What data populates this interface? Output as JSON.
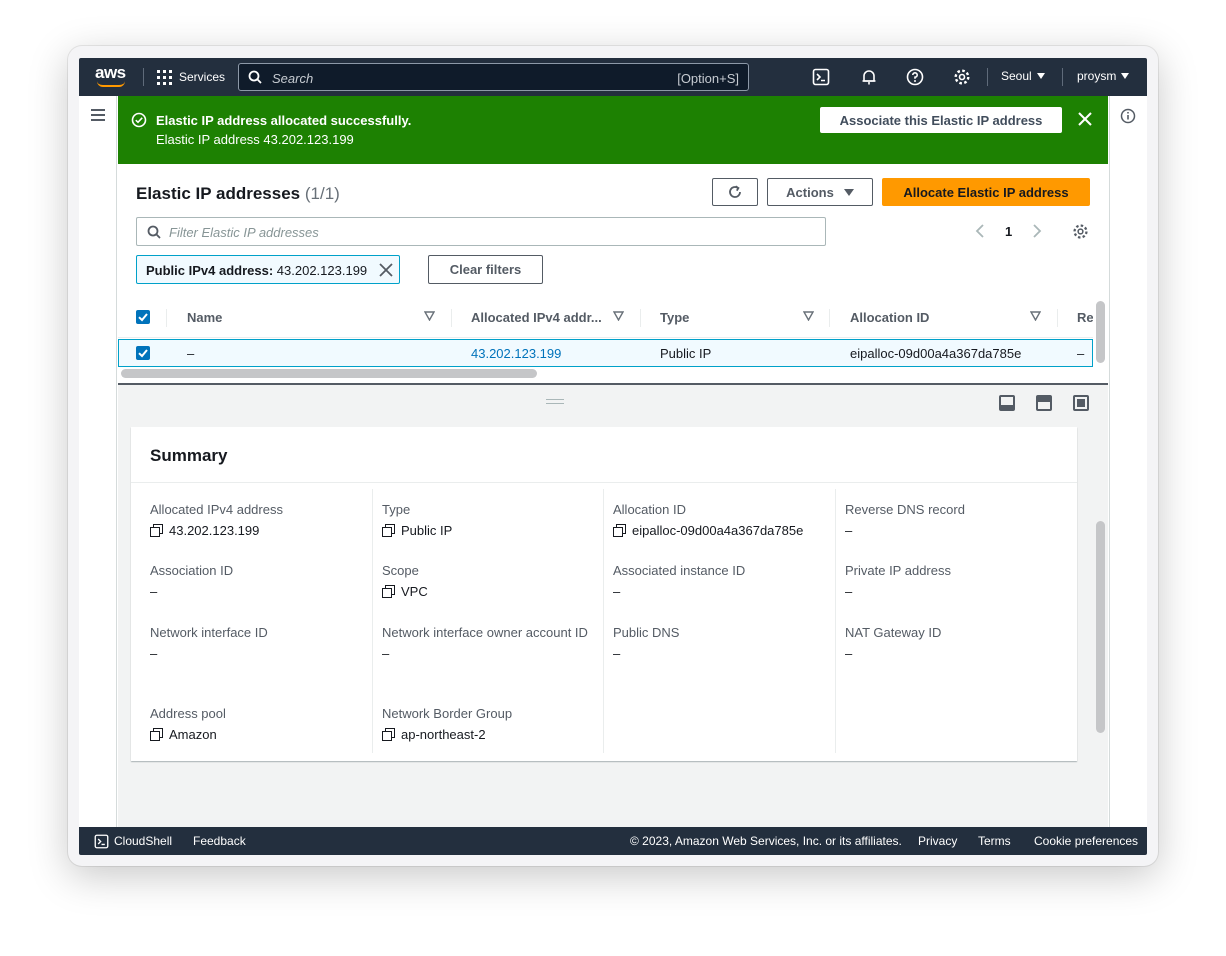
{
  "nav": {
    "logo_text": "aws",
    "services_label": "Services",
    "search_placeholder": "Search",
    "search_shortcut": "[Option+S]",
    "region": "Seoul",
    "user": "proysm"
  },
  "flash": {
    "title": "Elastic IP address allocated successfully.",
    "message": "Elastic IP address 43.202.123.199",
    "action_label": "Associate this Elastic IP address",
    "color": "#1d8102"
  },
  "list": {
    "title": "Elastic IP addresses",
    "count": "(1/1)",
    "actions_label": "Actions",
    "allocate_label": "Allocate Elastic IP address",
    "filter_placeholder": "Filter Elastic IP addresses",
    "page": "1",
    "chip_key": "Public IPv4 address:",
    "chip_value": "43.202.123.199",
    "clear_filters_label": "Clear filters",
    "columns": [
      "Name",
      "Allocated IPv4 addr...",
      "Type",
      "Allocation ID",
      "Re"
    ],
    "rows": [
      {
        "name": "–",
        "ip": "43.202.123.199",
        "type": "Public IP",
        "allocation_id": "eipalloc-09d00a4a367da785e",
        "reverse": "–"
      }
    ]
  },
  "summary": {
    "title": "Summary",
    "fields": [
      {
        "label": "Allocated IPv4 address",
        "value": "43.202.123.199"
      },
      {
        "label": "Type",
        "value": "Public IP"
      },
      {
        "label": "Allocation ID",
        "value": "eipalloc-09d00a4a367da785e"
      },
      {
        "label": "Reverse DNS record",
        "value": "–"
      },
      {
        "label": "Association ID",
        "value": "–"
      },
      {
        "label": "Scope",
        "value": "VPC"
      },
      {
        "label": "Associated instance ID",
        "value": "–"
      },
      {
        "label": "Private IP address",
        "value": "–"
      },
      {
        "label": "Network interface ID",
        "value": "–"
      },
      {
        "label": "Network interface owner account ID",
        "value": "–"
      },
      {
        "label": "Public DNS",
        "value": "–"
      },
      {
        "label": "NAT Gateway ID",
        "value": "–"
      },
      {
        "label": "Address pool",
        "value": "Amazon"
      },
      {
        "label": "Network Border Group",
        "value": "ap-northeast-2"
      }
    ]
  },
  "footer": {
    "cloudshell": "CloudShell",
    "feedback": "Feedback",
    "copyright": "© 2023, Amazon Web Services, Inc. or its affiliates.",
    "privacy": "Privacy",
    "terms": "Terms",
    "cookies": "Cookie preferences"
  },
  "colors": {
    "nav_bg": "#232f3e",
    "accent": "#ff9900",
    "link": "#0073bb",
    "success": "#1d8102"
  }
}
